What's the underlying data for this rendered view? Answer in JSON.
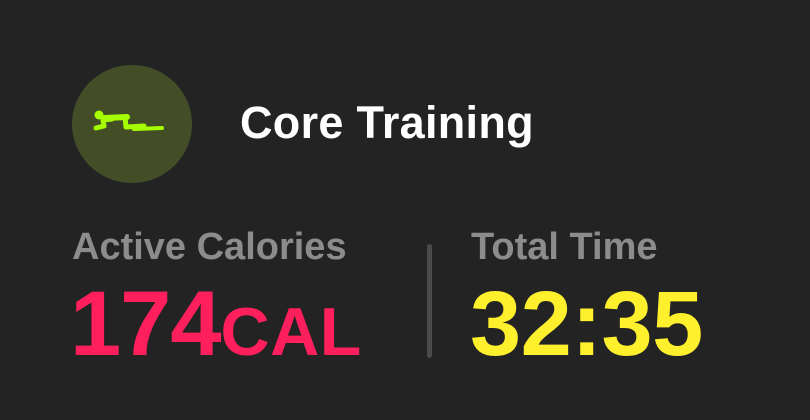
{
  "workout": {
    "title": "Core Training",
    "icon": "core-training-icon",
    "icon_color": "#a6ff00",
    "icon_background": "#444e26"
  },
  "stats": {
    "active_calories": {
      "label": "Active Calories",
      "value": "174",
      "unit": "CAL",
      "color": "#ff1f5c"
    },
    "total_time": {
      "label": "Total Time",
      "value": "32:35",
      "color": "#fff02e"
    }
  },
  "colors": {
    "background": "#232324",
    "title": "#ffffff",
    "label": "#8c8c8c",
    "divider": "#4a4a4b"
  }
}
